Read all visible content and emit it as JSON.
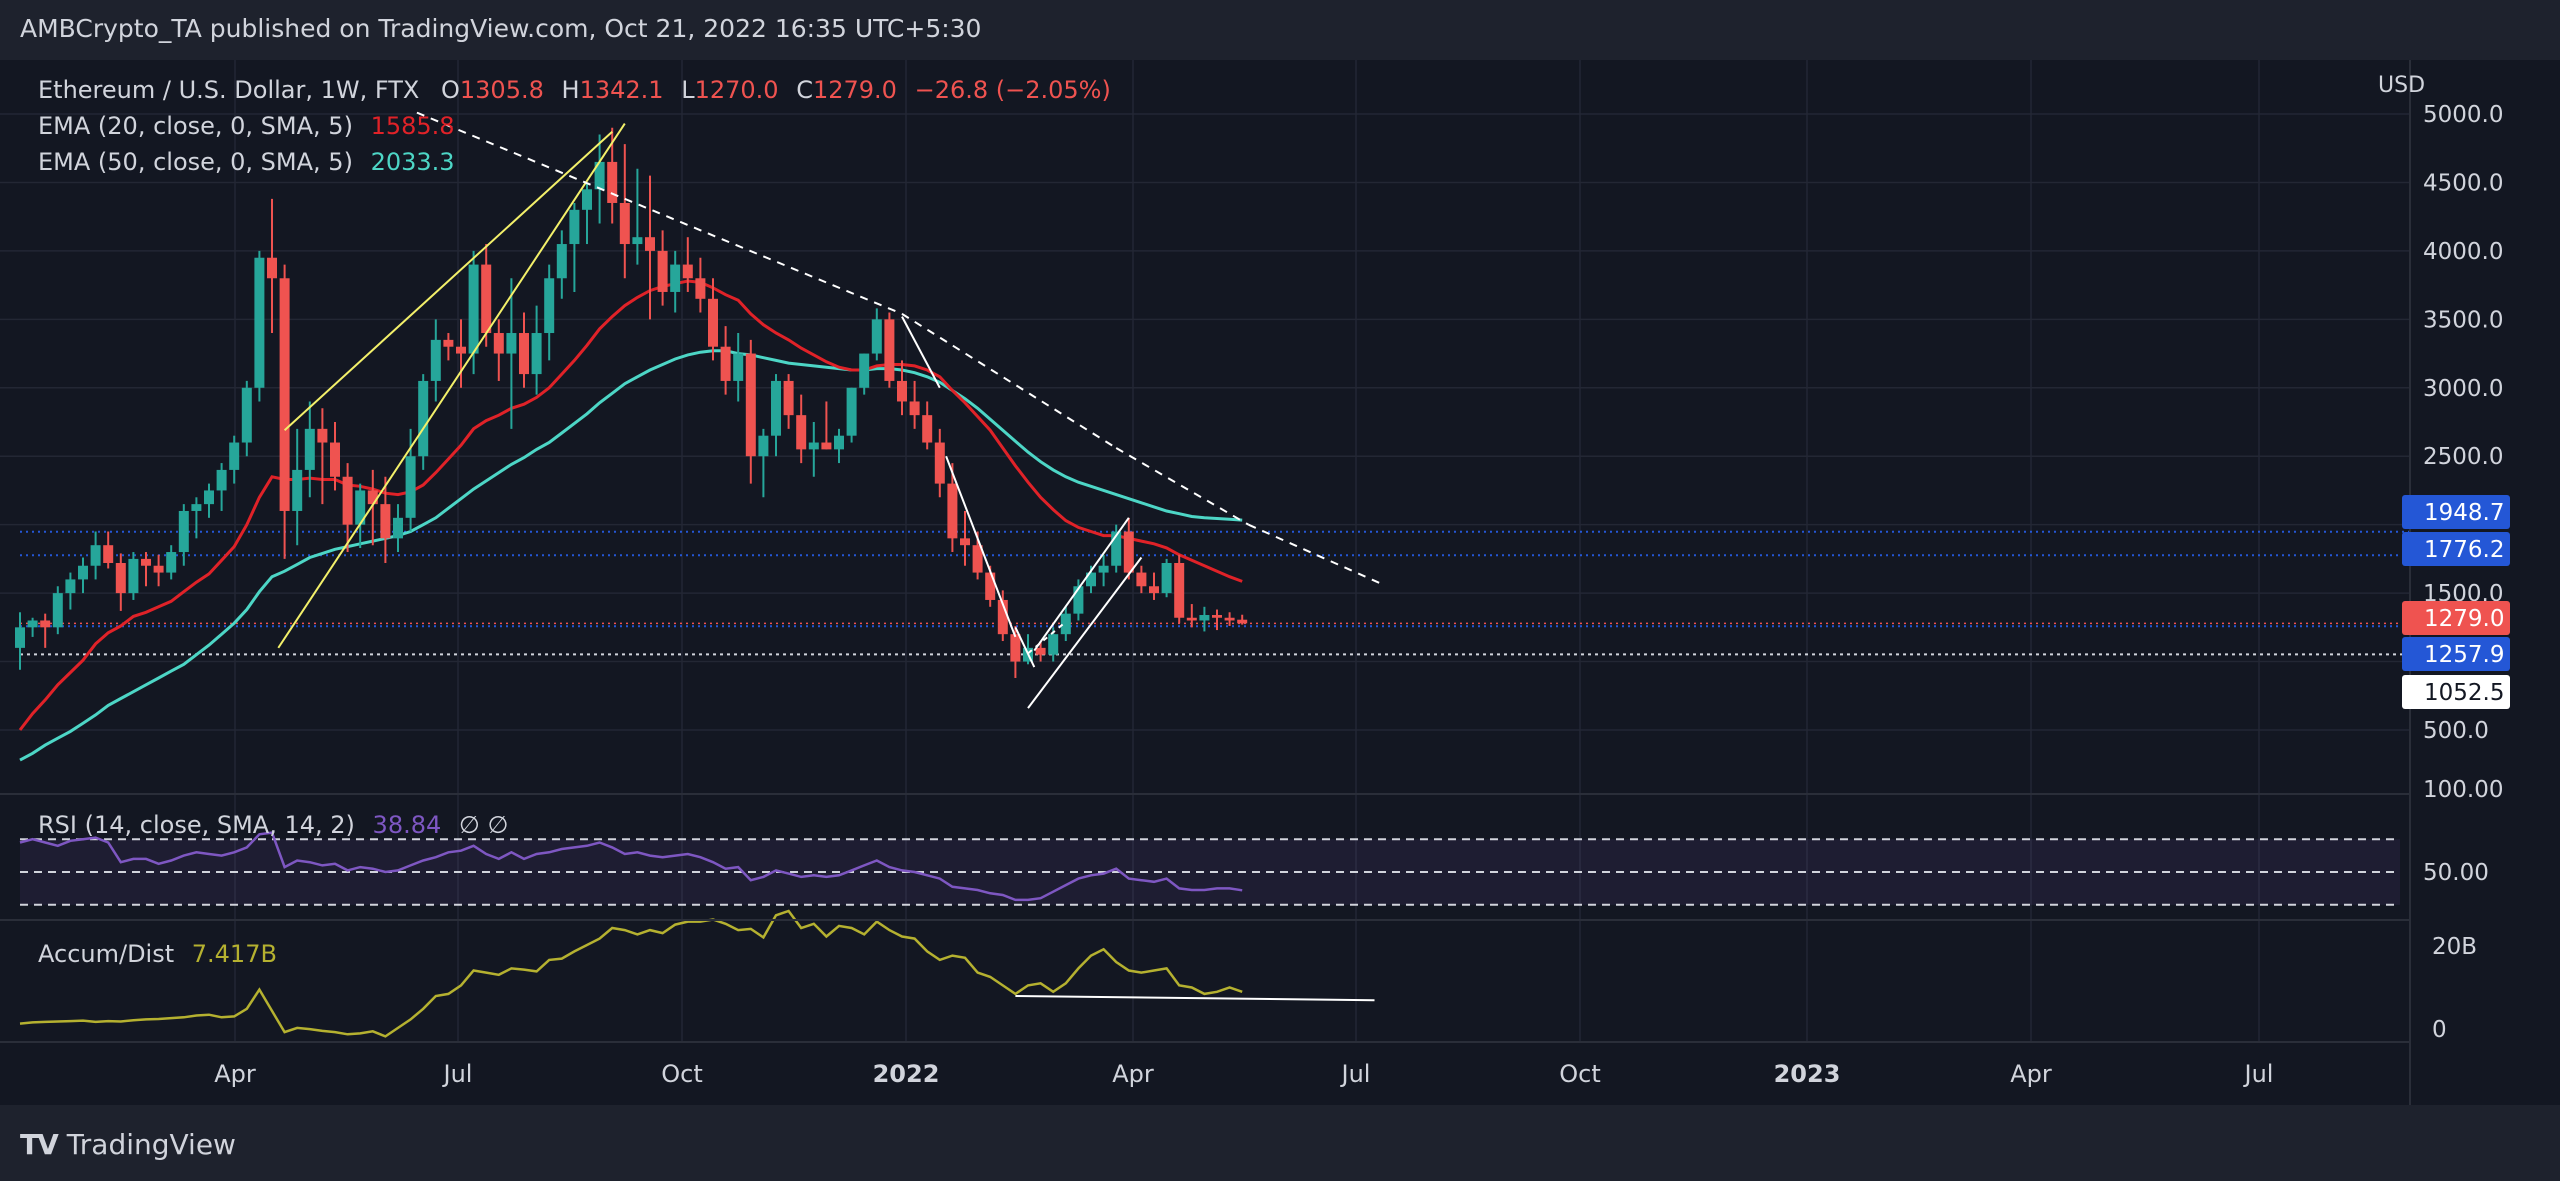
{
  "publisher_line": "AMBCrypto_TA published on TradingView.com, Oct 21, 2022 16:35 UTC+5:30",
  "brand": {
    "logo": "TV",
    "name": "TradingView"
  },
  "colors": {
    "background": "#131722",
    "frame": "#1e222d",
    "grid": "#232734",
    "text": "#d1d4dc",
    "up": "#26a69a",
    "down": "#ef5350",
    "ema20": "#e02228",
    "ema50": "#4dd6c6",
    "rsi": "#7e57c2",
    "accum": "#b5b130",
    "trend": "#f3f06a",
    "level_blue": "#2457d6"
  },
  "legend": {
    "symbol": "Ethereum / U.S. Dollar, 1W, FTX",
    "o_label": "O",
    "o_value": "1305.8",
    "h_label": "H",
    "h_value": "1342.1",
    "l_label": "L",
    "l_value": "1270.0",
    "c_label": "C",
    "c_value": "1279.0",
    "change": "−26.8 (−2.05%)",
    "ema20_label": "EMA (20, close, 0, SMA, 5)",
    "ema20_value": "1585.8",
    "ema50_label": "EMA (50, close, 0, SMA, 5)",
    "ema50_value": "2033.3",
    "rsi_label": "RSI (14, close, SMA, 14, 2)",
    "rsi_value": "38.84",
    "rsi_extra": "∅ ∅",
    "ad_label": "Accum/Dist",
    "ad_value": "7.417B"
  },
  "price_axis": {
    "currency": "USD",
    "ticks": [
      "5000.0",
      "4500.0",
      "4000.0",
      "3500.0",
      "3000.0",
      "2500.0",
      "1500.0",
      "500.0"
    ],
    "tags": [
      {
        "text": "1948.7",
        "value": 1948.7,
        "style": "blue"
      },
      {
        "text": "1776.2",
        "value": 1776.2,
        "style": "blue"
      },
      {
        "text": "1279.0",
        "value": 1279.0,
        "style": "red"
      },
      {
        "text": "1257.9",
        "value": 1257.9,
        "style": "blue"
      },
      {
        "text": "1052.5",
        "value": 1052.5,
        "style": "white"
      }
    ]
  },
  "rsi_axis": {
    "ticks": [
      "100.00",
      "50.00"
    ]
  },
  "ad_axis": {
    "ticks": [
      "20B",
      "0"
    ]
  },
  "time_axis": {
    "labels": [
      "Apr",
      "Jul",
      "Oct",
      "2022",
      "Apr",
      "Jul",
      "Oct",
      "2023",
      "Apr",
      "Jul"
    ]
  },
  "chart_data": {
    "type": "candlestick",
    "timeframe": "1W",
    "ylim": [
      -400,
      5100
    ],
    "candles": [
      [
        1100,
        1360,
        940,
        1250
      ],
      [
        1250,
        1320,
        1180,
        1300
      ],
      [
        1300,
        1350,
        1100,
        1250
      ],
      [
        1250,
        1550,
        1200,
        1500
      ],
      [
        1500,
        1650,
        1380,
        1600
      ],
      [
        1600,
        1760,
        1500,
        1700
      ],
      [
        1700,
        1950,
        1600,
        1850
      ],
      [
        1850,
        1950,
        1680,
        1720
      ],
      [
        1720,
        1790,
        1370,
        1500
      ],
      [
        1500,
        1800,
        1450,
        1750
      ],
      [
        1750,
        1800,
        1550,
        1700
      ],
      [
        1700,
        1780,
        1550,
        1650
      ],
      [
        1650,
        1850,
        1600,
        1800
      ],
      [
        1800,
        2150,
        1700,
        2100
      ],
      [
        2100,
        2200,
        1900,
        2150
      ],
      [
        2150,
        2300,
        2050,
        2250
      ],
      [
        2250,
        2450,
        2100,
        2400
      ],
      [
        2400,
        2650,
        2300,
        2600
      ],
      [
        2600,
        3050,
        2500,
        3000
      ],
      [
        3000,
        4000,
        2900,
        3950
      ],
      [
        3950,
        4380,
        3400,
        3800
      ],
      [
        3800,
        3900,
        1750,
        2100
      ],
      [
        2100,
        2700,
        1850,
        2400
      ],
      [
        2400,
        2900,
        2200,
        2700
      ],
      [
        2700,
        2850,
        2150,
        2600
      ],
      [
        2600,
        2750,
        2250,
        2350
      ],
      [
        2350,
        2450,
        1800,
        2000
      ],
      [
        2000,
        2300,
        1830,
        2250
      ],
      [
        2250,
        2400,
        1850,
        2150
      ],
      [
        2150,
        2350,
        1720,
        1900
      ],
      [
        1900,
        2150,
        1800,
        2050
      ],
      [
        2050,
        2700,
        1950,
        2500
      ],
      [
        2500,
        3100,
        2400,
        3050
      ],
      [
        3050,
        3500,
        2900,
        3350
      ],
      [
        3350,
        3400,
        3200,
        3300
      ],
      [
        3300,
        3500,
        3000,
        3250
      ],
      [
        3250,
        4000,
        3100,
        3900
      ],
      [
        3900,
        4050,
        3300,
        3400
      ],
      [
        3400,
        3500,
        3050,
        3250
      ],
      [
        3250,
        3800,
        2700,
        3400
      ],
      [
        3400,
        3550,
        3000,
        3100
      ],
      [
        3100,
        3600,
        2950,
        3400
      ],
      [
        3400,
        3900,
        3200,
        3800
      ],
      [
        3800,
        4150,
        3650,
        4050
      ],
      [
        4050,
        4350,
        3700,
        4300
      ],
      [
        4300,
        4500,
        4050,
        4450
      ],
      [
        4450,
        4850,
        4200,
        4650
      ],
      [
        4650,
        4900,
        4200,
        4350
      ],
      [
        4350,
        4780,
        3800,
        4050
      ],
      [
        4050,
        4600,
        3900,
        4100
      ],
      [
        4100,
        4550,
        3500,
        4000
      ],
      [
        4000,
        4150,
        3600,
        3700
      ],
      [
        3700,
        4000,
        3550,
        3900
      ],
      [
        3900,
        4100,
        3700,
        3800
      ],
      [
        3800,
        3950,
        3550,
        3650
      ],
      [
        3650,
        3800,
        3200,
        3300
      ],
      [
        3300,
        3450,
        2950,
        3050
      ],
      [
        3050,
        3400,
        2900,
        3250
      ],
      [
        3250,
        3350,
        2300,
        2500
      ],
      [
        2500,
        2700,
        2200,
        2650
      ],
      [
        2650,
        3100,
        2500,
        3050
      ],
      [
        3050,
        3100,
        2700,
        2800
      ],
      [
        2800,
        2950,
        2450,
        2550
      ],
      [
        2550,
        2750,
        2350,
        2600
      ],
      [
        2600,
        2900,
        2550,
        2550
      ],
      [
        2550,
        2700,
        2450,
        2650
      ],
      [
        2650,
        3000,
        2600,
        3000
      ],
      [
        3000,
        3250,
        2950,
        3250
      ],
      [
        3250,
        3580,
        3200,
        3500
      ],
      [
        3500,
        3550,
        3000,
        3050
      ],
      [
        3050,
        3200,
        2800,
        2900
      ],
      [
        2900,
        3050,
        2700,
        2800
      ],
      [
        2800,
        2900,
        2550,
        2600
      ],
      [
        2600,
        2700,
        2200,
        2300
      ],
      [
        2300,
        2450,
        1800,
        1900
      ],
      [
        1900,
        2100,
        1700,
        1850
      ],
      [
        1850,
        1950,
        1600,
        1650
      ],
      [
        1650,
        1700,
        1400,
        1450
      ],
      [
        1450,
        1520,
        1150,
        1200
      ],
      [
        1200,
        1260,
        880,
        1000
      ],
      [
        1000,
        1200,
        980,
        1100
      ],
      [
        1100,
        1150,
        1000,
        1050
      ],
      [
        1050,
        1250,
        1000,
        1200
      ],
      [
        1200,
        1400,
        1150,
        1350
      ],
      [
        1350,
        1600,
        1300,
        1550
      ],
      [
        1550,
        1700,
        1500,
        1650
      ],
      [
        1650,
        1780,
        1550,
        1700
      ],
      [
        1700,
        2000,
        1650,
        1950
      ],
      [
        1950,
        2050,
        1600,
        1650
      ],
      [
        1650,
        1700,
        1500,
        1550
      ],
      [
        1550,
        1650,
        1450,
        1500
      ],
      [
        1500,
        1750,
        1470,
        1720
      ],
      [
        1720,
        1780,
        1280,
        1320
      ],
      [
        1320,
        1420,
        1250,
        1300
      ],
      [
        1300,
        1400,
        1220,
        1340
      ],
      [
        1340,
        1380,
        1230,
        1320
      ],
      [
        1320,
        1360,
        1260,
        1300
      ],
      [
        1305.8,
        1342.1,
        1270.0,
        1279.0
      ]
    ],
    "ema20": [
      500,
      620,
      720,
      830,
      920,
      1010,
      1130,
      1210,
      1260,
      1330,
      1360,
      1400,
      1440,
      1510,
      1580,
      1640,
      1740,
      1840,
      2000,
      2200,
      2350,
      2330,
      2330,
      2340,
      2330,
      2330,
      2290,
      2280,
      2260,
      2230,
      2220,
      2240,
      2290,
      2380,
      2480,
      2580,
      2700,
      2760,
      2800,
      2850,
      2880,
      2930,
      3000,
      3100,
      3200,
      3310,
      3430,
      3520,
      3600,
      3660,
      3710,
      3740,
      3760,
      3780,
      3770,
      3730,
      3680,
      3640,
      3540,
      3460,
      3400,
      3350,
      3290,
      3240,
      3190,
      3150,
      3130,
      3130,
      3160,
      3170,
      3170,
      3160,
      3130,
      3080,
      2980,
      2890,
      2790,
      2690,
      2560,
      2430,
      2310,
      2200,
      2110,
      2030,
      1980,
      1950,
      1920,
      1920,
      1900,
      1880,
      1860,
      1830,
      1780,
      1740,
      1700,
      1660,
      1620,
      1585.8
    ],
    "ema50": [
      280,
      330,
      390,
      440,
      490,
      550,
      610,
      680,
      730,
      780,
      830,
      880,
      930,
      980,
      1050,
      1120,
      1200,
      1280,
      1380,
      1510,
      1620,
      1660,
      1710,
      1760,
      1790,
      1820,
      1840,
      1860,
      1880,
      1900,
      1920,
      1950,
      2000,
      2050,
      2120,
      2190,
      2260,
      2320,
      2380,
      2440,
      2490,
      2550,
      2600,
      2670,
      2740,
      2810,
      2890,
      2960,
      3030,
      3080,
      3130,
      3170,
      3210,
      3240,
      3260,
      3270,
      3270,
      3250,
      3240,
      3220,
      3200,
      3180,
      3170,
      3160,
      3150,
      3140,
      3130,
      3130,
      3140,
      3140,
      3130,
      3110,
      3080,
      3040,
      2980,
      2920,
      2850,
      2770,
      2690,
      2610,
      2530,
      2460,
      2400,
      2350,
      2310,
      2280,
      2250,
      2220,
      2190,
      2160,
      2130,
      2100,
      2080,
      2060,
      2050,
      2045,
      2040,
      2033.3
    ],
    "rsi": [
      68,
      70,
      68,
      66,
      69,
      70,
      71,
      68,
      56,
      58,
      58,
      55,
      57,
      60,
      62,
      61,
      60,
      62,
      65,
      73,
      74,
      53,
      57,
      56,
      54,
      55,
      51,
      53,
      52,
      50,
      51,
      54,
      57,
      59,
      62,
      63,
      66,
      61,
      58,
      62,
      58,
      61,
      62,
      64,
      65,
      66,
      68,
      65,
      61,
      62,
      60,
      59,
      60,
      61,
      59,
      56,
      52,
      53,
      45,
      47,
      51,
      49,
      47,
      48,
      47,
      48,
      51,
      54,
      57,
      53,
      51,
      50,
      48,
      46,
      41,
      40,
      39,
      37,
      36,
      33,
      33,
      34,
      38,
      42,
      46,
      48,
      49,
      52,
      46,
      45,
      44,
      46,
      40,
      39,
      39,
      40,
      40,
      38.84
    ],
    "accum_dist": [
      1.5,
      1.8,
      1.9,
      2.0,
      2.1,
      2.2,
      1.9,
      2.1,
      2.0,
      2.3,
      2.5,
      2.6,
      2.8,
      3.0,
      3.4,
      3.6,
      3.0,
      3.2,
      5.0,
      9.5,
      4.5,
      -0.5,
      0.5,
      0.2,
      -0.2,
      -0.5,
      -1.0,
      -0.8,
      -0.3,
      -1.5,
      0.5,
      2.5,
      5.0,
      8.0,
      8.5,
      10.5,
      14.0,
      13.5,
      13.0,
      14.5,
      14.2,
      13.8,
      16.5,
      16.8,
      18.5,
      20.0,
      21.5,
      24.0,
      23.5,
      22.5,
      23.5,
      22.8,
      24.8,
      25.5,
      25.5,
      26.0,
      25.0,
      23.5,
      23.8,
      21.8,
      27.0,
      28.0,
      24.0,
      25.0,
      22.0,
      24.5,
      24.0,
      22.5,
      25.5,
      23.5,
      22.0,
      21.5,
      18.5,
      16.5,
      17.5,
      17.0,
      13.5,
      12.5,
      10.5,
      8.5,
      10.5,
      11.0,
      9.0,
      11.0,
      14.5,
      17.5,
      19.0,
      16.0,
      14.0,
      13.5,
      14.0,
      14.5,
      10.5,
      10.0,
      8.5,
      9.0,
      10.0,
      9.0
    ],
    "rsi_band": {
      "upper": 70,
      "middle": 50,
      "lower": 30
    },
    "horizontal_levels": [
      1948.7,
      1776.2,
      1257.9,
      1052.5
    ],
    "drawings": {
      "rising_channel_1": [
        [
          0,
          1140
        ],
        [
          -1,
          1900
        ]
      ],
      "wedge_yellow": [
        [
          [
            20,
            2690
          ],
          [
            47,
            4860
          ]
        ],
        [
          [
            29,
            800
          ],
          [
            53,
            4600
          ]
        ]
      ],
      "descending_trendline": [
        [
          38,
          5000
        ],
        [
          70,
          3500
        ],
        [
          93,
          1980
        ],
        [
          107,
          1520
        ]
      ],
      "fall_line": [
        [
          70,
          3500
        ],
        [
          73,
          2950
        ]
      ],
      "rising_channel": [
        [
          [
            80,
            1050
          ],
          [
            88,
            2050
          ]
        ],
        [
          [
            82,
            760
          ],
          [
            90,
            1700
          ]
        ]
      ],
      "rsi_level_dashes": true,
      "ad_support": [
        [
          80,
          7.9
        ],
        [
          104,
          7.0
        ]
      ]
    }
  }
}
